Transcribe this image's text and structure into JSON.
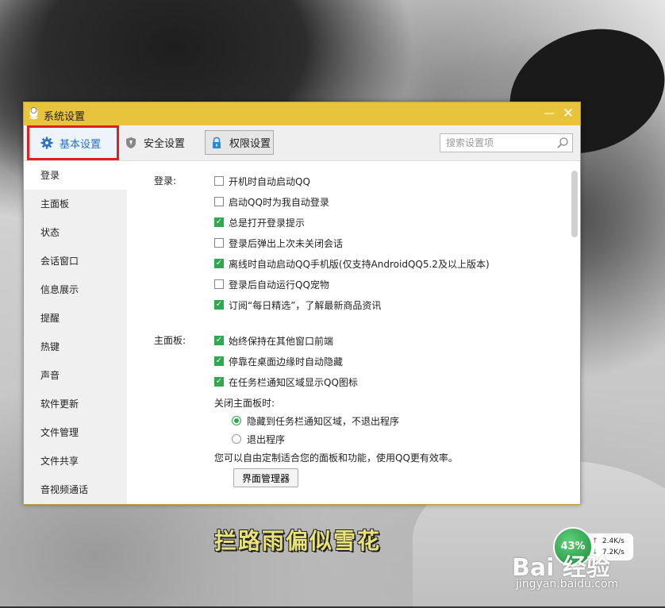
{
  "window": {
    "title": "系统设置",
    "minimize_symbol": "—",
    "close_symbol": "✕"
  },
  "toolbar": {
    "tabs": [
      {
        "label": "基本设置",
        "icon": "gear-icon",
        "selected": true
      },
      {
        "label": "安全设置",
        "icon": "shield-icon",
        "selected": false
      },
      {
        "label": "权限设置",
        "icon": "lock-icon",
        "selected": false
      }
    ],
    "search_placeholder": "搜索设置项"
  },
  "sidebar": {
    "items": [
      "登录",
      "主面板",
      "状态",
      "会话窗口",
      "信息展示",
      "提醒",
      "热键",
      "声音",
      "软件更新",
      "文件管理",
      "文件共享",
      "音视频通话"
    ],
    "active_index": 0
  },
  "login_section": {
    "label": "登录:",
    "options": [
      {
        "label": "开机时自动启动QQ",
        "checked": false
      },
      {
        "label": "启动QQ时为我自动登录",
        "checked": false
      },
      {
        "label": "总是打开登录提示",
        "checked": true
      },
      {
        "label": "登录后弹出上次未关闭会话",
        "checked": false
      },
      {
        "label": "离线时自动启动QQ手机版(仅支持AndroidQQ5.2及以上版本)",
        "checked": true
      },
      {
        "label": "登录后自动运行QQ宠物",
        "checked": false
      },
      {
        "label": "订阅“每日精选”，了解最新商品资讯",
        "checked": true
      }
    ]
  },
  "panel_section": {
    "label": "主面板:",
    "options": [
      {
        "label": "始终保持在其他窗口前端",
        "checked": true
      },
      {
        "label": "停靠在桌面边缘时自动隐藏",
        "checked": true
      },
      {
        "label": "在任务栏通知区域显示QQ图标",
        "checked": true
      }
    ],
    "close_label": "关闭主面板时:",
    "radios": [
      {
        "label": "隐藏到任务栏通知区域，不退出程序",
        "checked": true
      },
      {
        "label": "退出程序",
        "checked": false
      }
    ],
    "hint": "您可以自由定制适合您的面板和功能，使用QQ更有效率。",
    "manager_button": "界面管理器"
  },
  "subtitle": "拦路雨偏似雪花",
  "net_widget": {
    "percent": "43%",
    "upload": "2.4K/s",
    "download": "7.2K/s",
    "up_arrow": "↑",
    "down_arrow": "↓"
  },
  "watermark": {
    "brand": "Bai 经验",
    "url": "jingyan.baidu.com"
  },
  "colors": {
    "titlebar": "#e8c33c",
    "accent_green": "#2fa84f",
    "highlight_red": "#e02020",
    "selected_tab_text": "#2a72c4"
  }
}
